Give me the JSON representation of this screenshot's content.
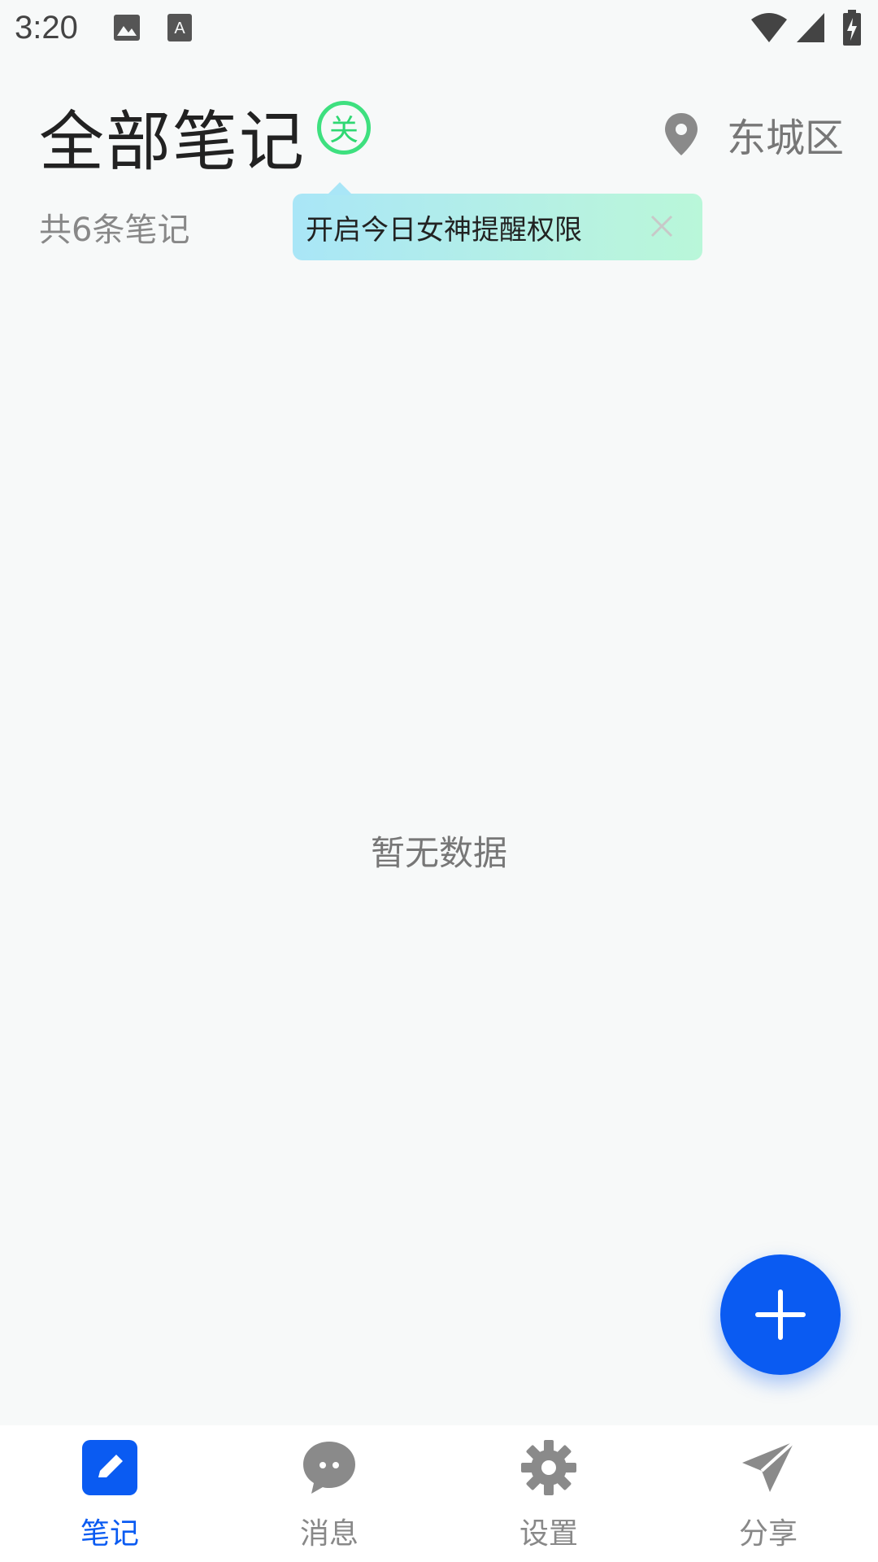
{
  "status_bar": {
    "time": "3:20"
  },
  "header": {
    "title": "全部笔记",
    "toggle_label": "关",
    "location": "东城区"
  },
  "summary": {
    "note_count": "共6条笔记"
  },
  "tooltip": {
    "text": "开启今日女神提醒权限"
  },
  "main": {
    "empty_text": "暂无数据"
  },
  "fab": {
    "icon": "plus-icon"
  },
  "nav": {
    "items": [
      {
        "label": "笔记",
        "icon": "pencil-icon",
        "active": true
      },
      {
        "label": "消息",
        "icon": "chat-icon",
        "active": false
      },
      {
        "label": "设置",
        "icon": "gear-icon",
        "active": false
      },
      {
        "label": "分享",
        "icon": "send-icon",
        "active": false
      }
    ]
  },
  "colors": {
    "accent": "#0a5bf2",
    "toggle_green": "#2fd872",
    "background": "#f7f9f9"
  }
}
